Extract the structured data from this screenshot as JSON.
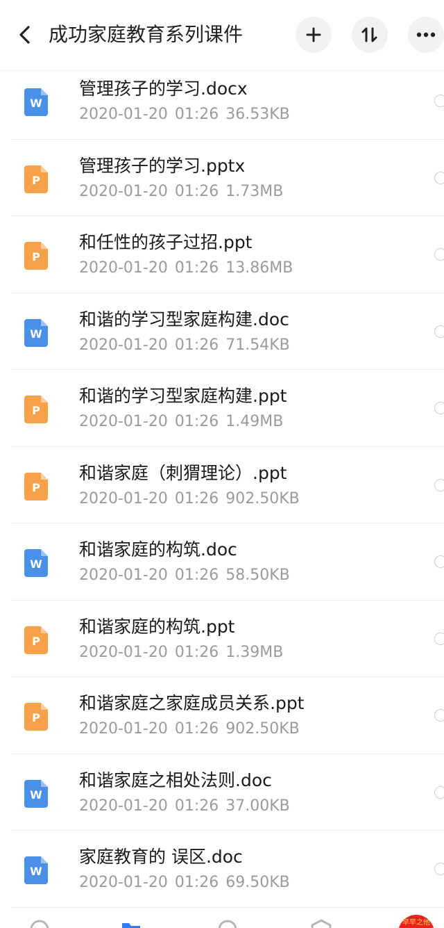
{
  "header": {
    "title": "成功家庭教育系列课件"
  },
  "files": [
    {
      "name": "管理孩子的学习.docx",
      "date": "2020-01-20",
      "time": "01:26",
      "size": "36.53KB",
      "type": "word",
      "badge": "W"
    },
    {
      "name": "管理孩子的学习.pptx",
      "date": "2020-01-20",
      "time": "01:26",
      "size": "1.73MB",
      "type": "ppt",
      "badge": "P"
    },
    {
      "name": "和任性的孩子过招.ppt",
      "date": "2020-01-20",
      "time": "01:26",
      "size": "13.86MB",
      "type": "ppt",
      "badge": "P"
    },
    {
      "name": "和谐的学习型家庭构建.doc",
      "date": "2020-01-20",
      "time": "01:26",
      "size": "71.54KB",
      "type": "word",
      "badge": "W"
    },
    {
      "name": "和谐的学习型家庭构建.ppt",
      "date": "2020-01-20",
      "time": "01:26",
      "size": "1.49MB",
      "type": "ppt",
      "badge": "P"
    },
    {
      "name": "和谐家庭（刺猬理论）.ppt",
      "date": "2020-01-20",
      "time": "01:26",
      "size": "902.50KB",
      "type": "ppt",
      "badge": "P"
    },
    {
      "name": "和谐家庭的构筑.doc",
      "date": "2020-01-20",
      "time": "01:26",
      "size": "58.50KB",
      "type": "word",
      "badge": "W"
    },
    {
      "name": "和谐家庭的构筑.ppt",
      "date": "2020-01-20",
      "time": "01:26",
      "size": "1.39MB",
      "type": "ppt",
      "badge": "P"
    },
    {
      "name": "和谐家庭之家庭成员关系.ppt",
      "date": "2020-01-20",
      "time": "01:26",
      "size": "902.50KB",
      "type": "ppt",
      "badge": "P"
    },
    {
      "name": "和谐家庭之相处法则.doc",
      "date": "2020-01-20",
      "time": "01:26",
      "size": "37.00KB",
      "type": "word",
      "badge": "W"
    },
    {
      "name": "家庭教育的  误区.doc",
      "date": "2020-01-20",
      "time": "01:26",
      "size": "69.50KB",
      "type": "word",
      "badge": "W"
    }
  ],
  "colors": {
    "word": "#4a90e8",
    "ppt": "#f7a24a",
    "tab_active": "#2f7cf6",
    "watermark": "#e8231e"
  },
  "icons": {
    "back": "chevron-left-icon",
    "add": "plus-icon",
    "sort": "sort-icon",
    "more": "more-horizontal-icon"
  },
  "watermark": {
    "text": "早早之他"
  }
}
